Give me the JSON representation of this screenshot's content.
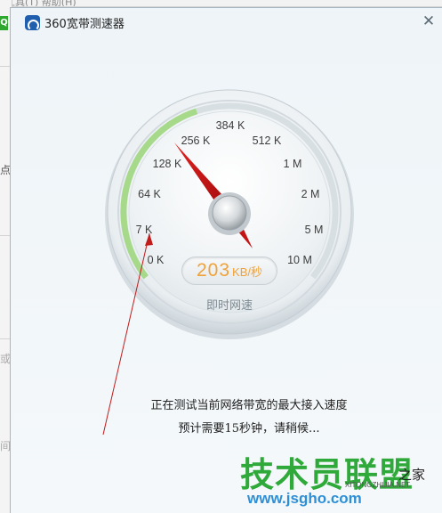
{
  "background_app": {
    "menu_text": "工具(T)  帮助(H)",
    "side_glyphs": [
      "点",
      "或",
      "间"
    ]
  },
  "window": {
    "title": "360宽带测速器",
    "close_glyph": "✕",
    "icon": "speedometer-app-icon"
  },
  "gauge": {
    "tick_labels": [
      "0 K",
      "7 K",
      "64 K",
      "128 K",
      "256 K",
      "384 K",
      "512 K",
      "1 M",
      "2 M",
      "5 M",
      "10 M"
    ],
    "needle_color": "#c41414",
    "arc_color": "#a6d98a"
  },
  "speed": {
    "value": "203",
    "unit": "KB/秒",
    "caption": "即时网速"
  },
  "status": {
    "line1": "正在测试当前网络带宽的最大接入速度",
    "line2": "预计需要15秒钟，请稍候..."
  },
  "watermark": {
    "main": "技术员联盟",
    "tag": "之家",
    "site": "www.jsgho.com",
    "small": "XITONGZHIJIA.NET"
  }
}
